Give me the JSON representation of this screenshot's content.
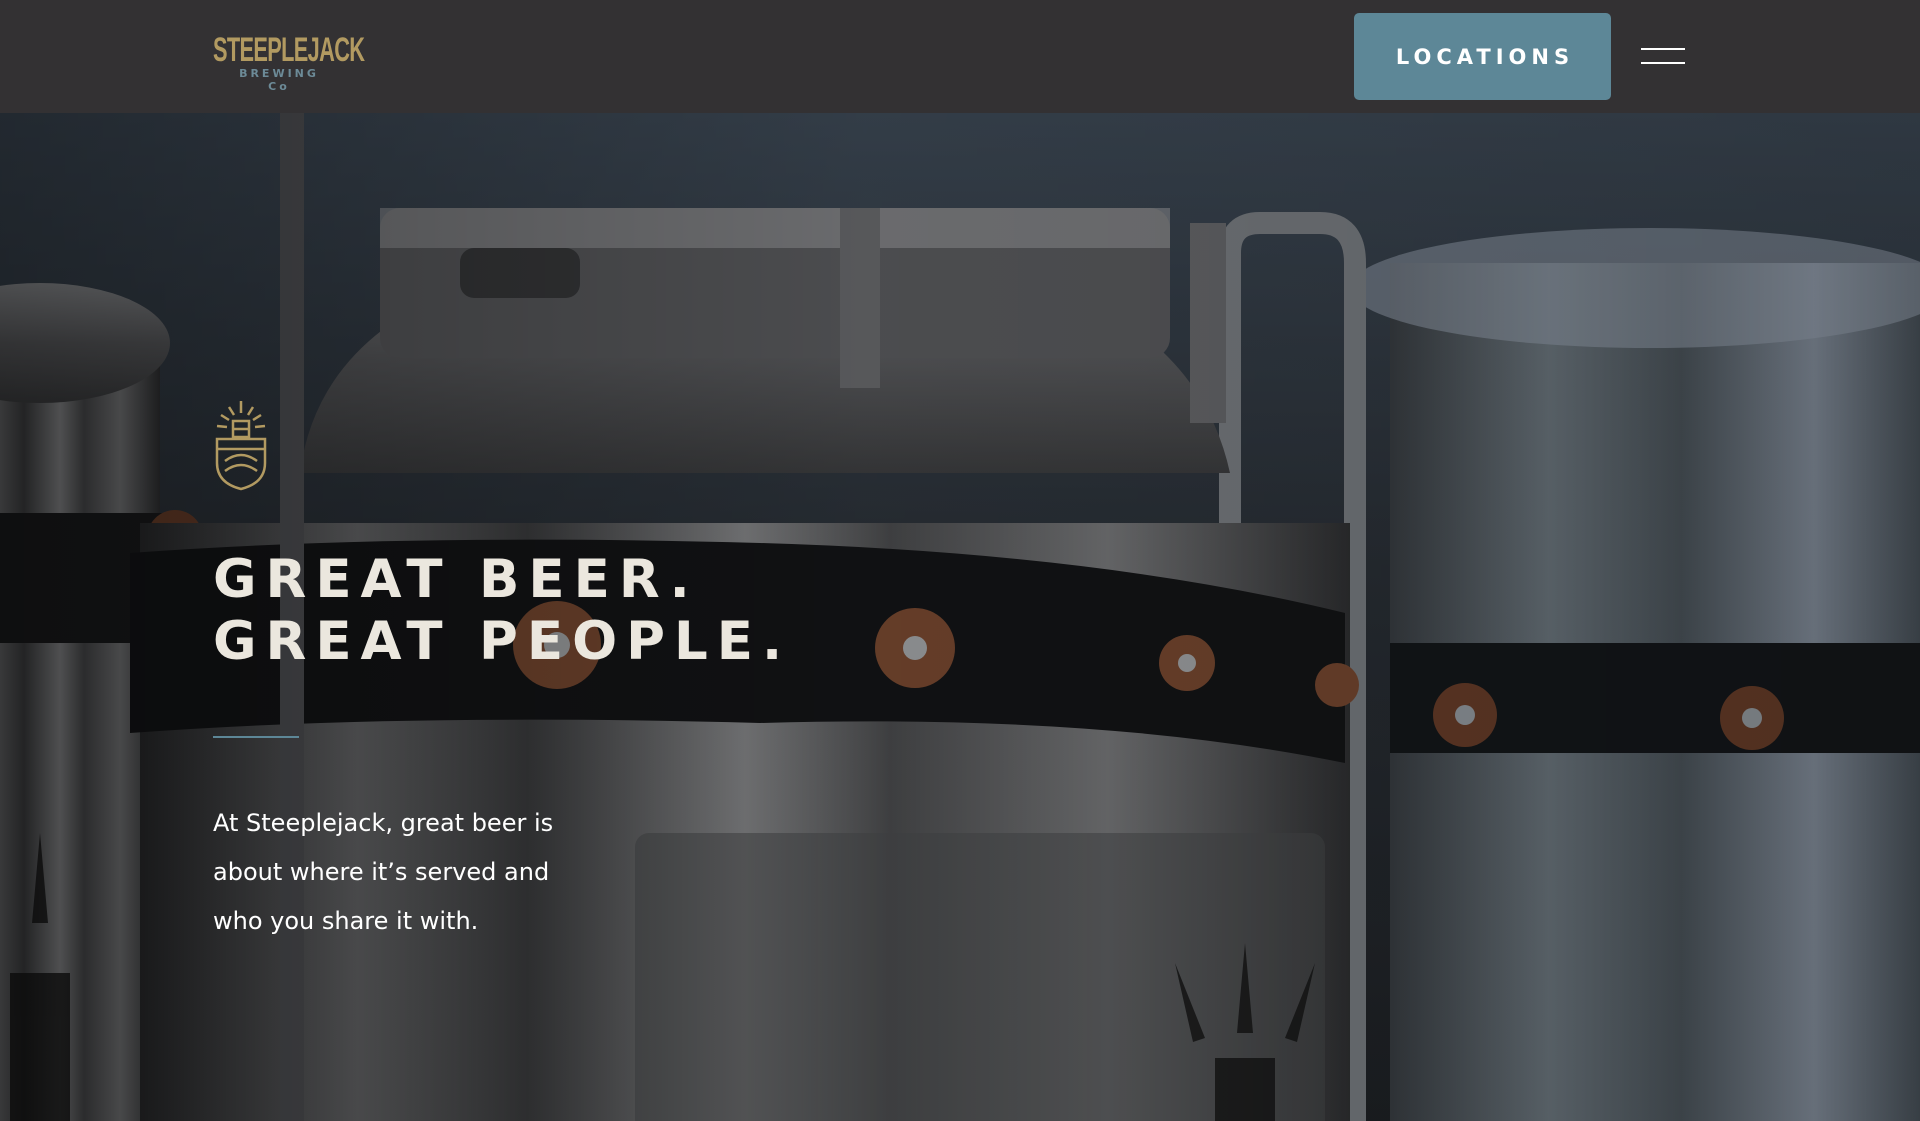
{
  "brand": {
    "name": "STEEPLEJACK",
    "subtitle": "BREWING Co",
    "gold": "#b29a61",
    "slate": "#6c8a97",
    "logo_icon": "steeplejack-wordmark"
  },
  "header": {
    "background": "#333133",
    "locations_label": "LOCATIONS",
    "locations_color": "#5d8797",
    "menu_icon": "hamburger-icon"
  },
  "hero": {
    "emblem_icon": "brewery-emblem-icon",
    "headline_line1": "GREAT BEER.",
    "headline_line2": "GREAT PEOPLE.",
    "intro_line1": "At Steeplejack, great beer is",
    "intro_line2": "about where it’s served and",
    "intro_line3": "who you share it with.",
    "background_image": "brewing-tanks-photo"
  }
}
